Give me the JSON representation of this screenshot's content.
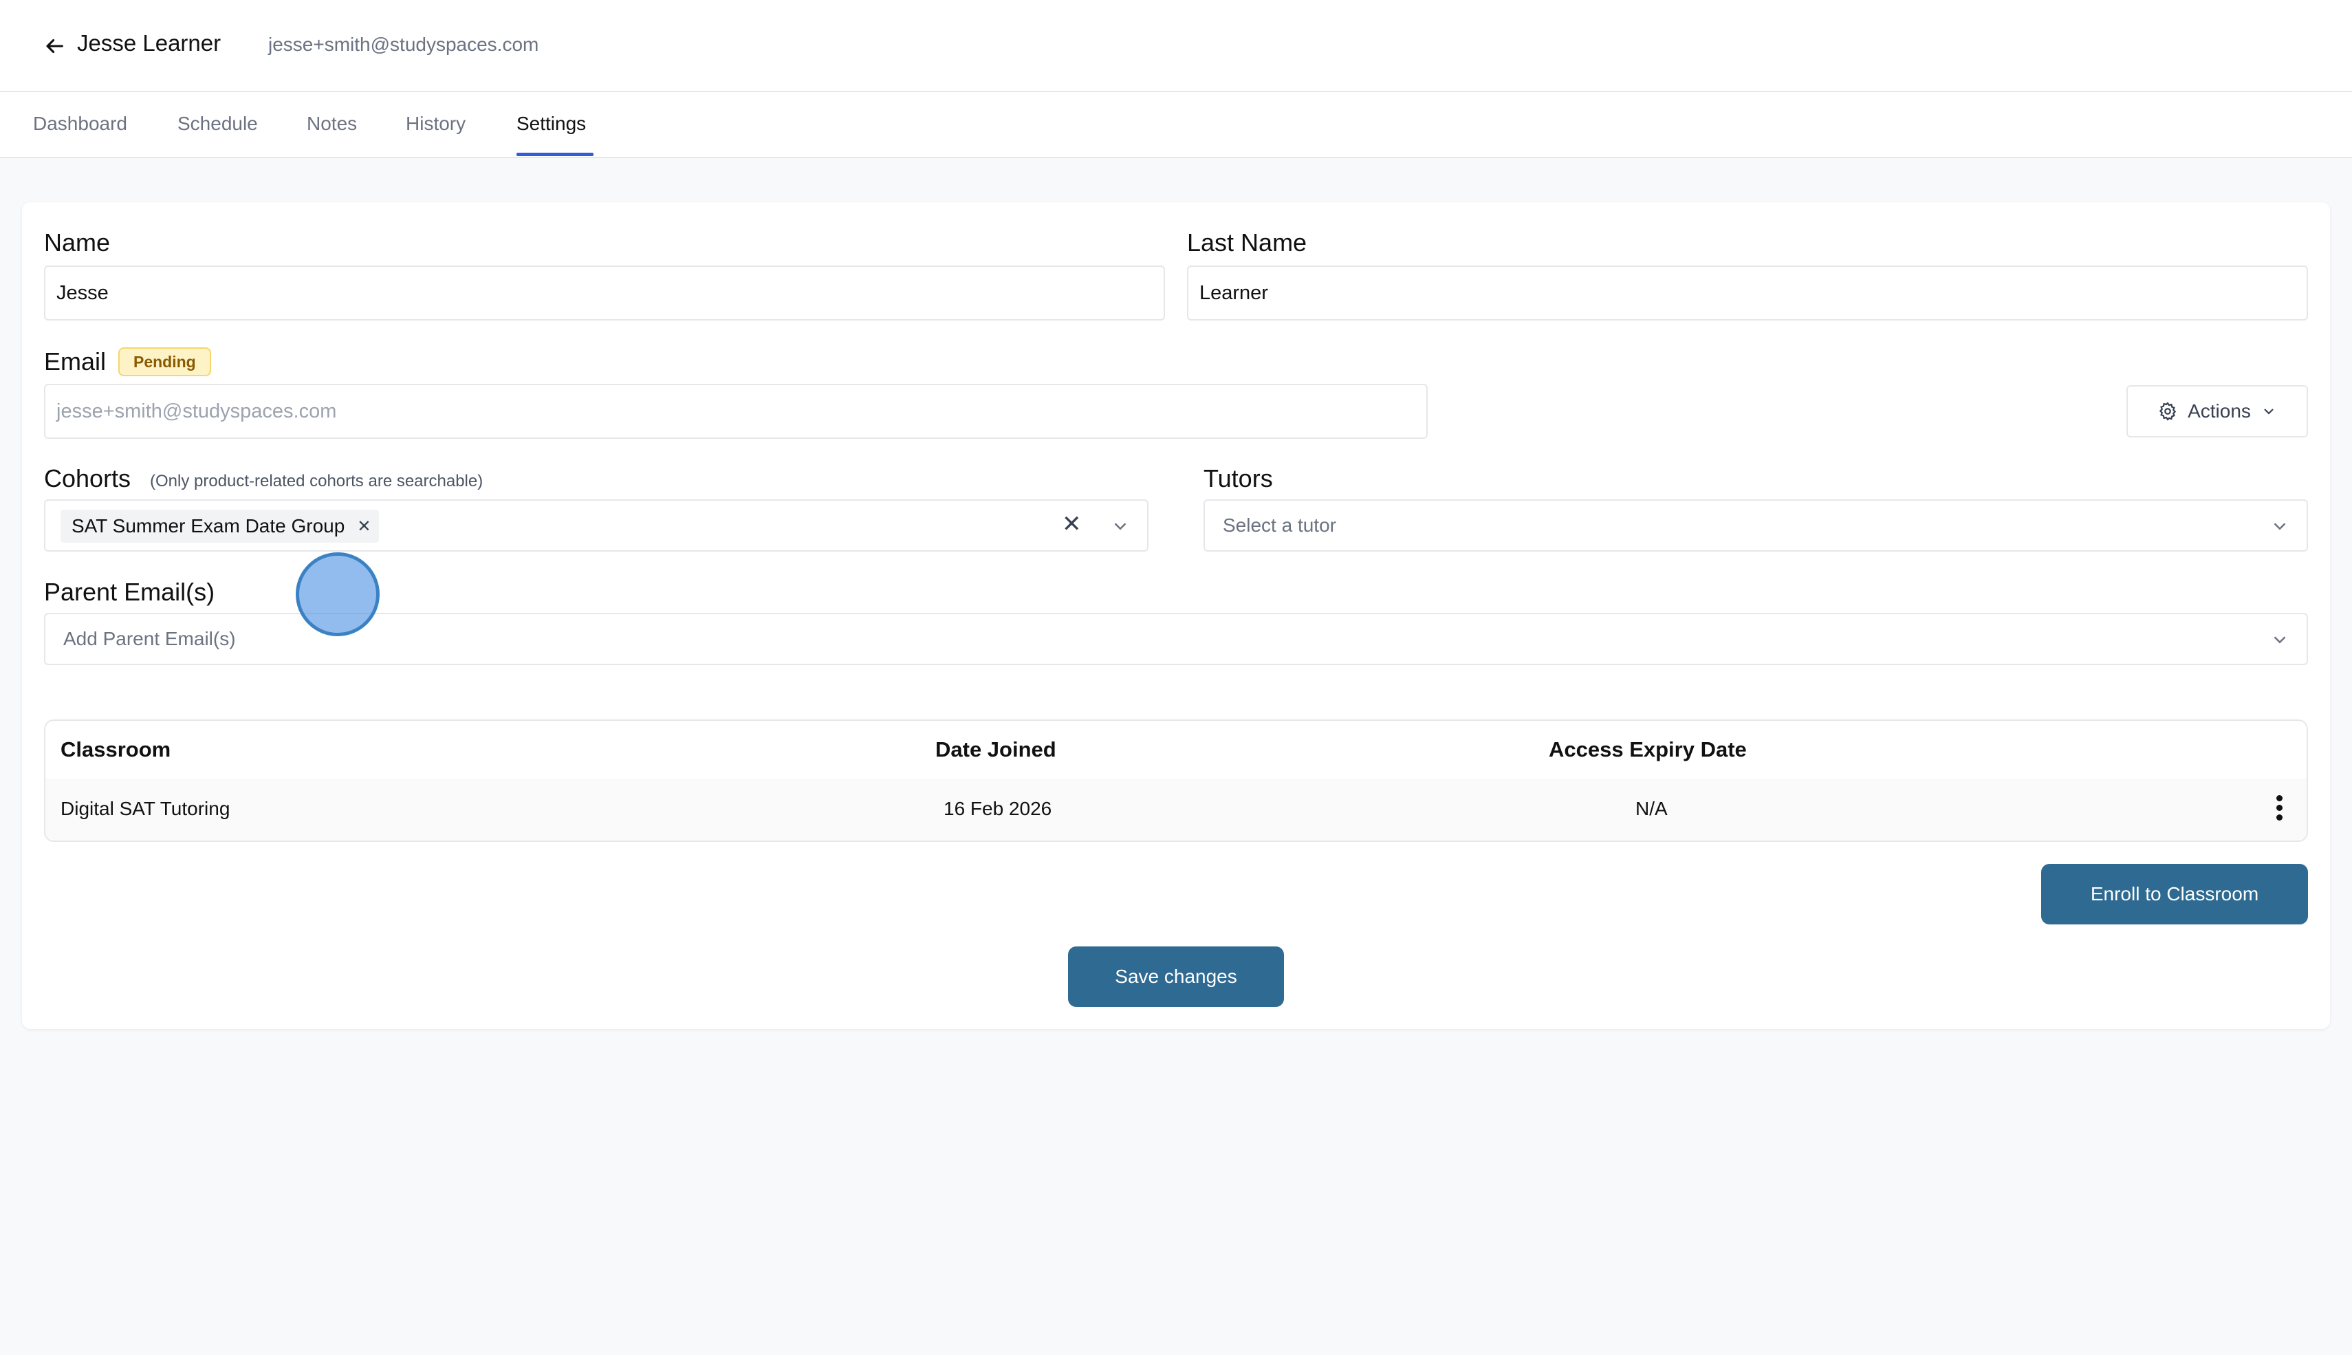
{
  "header": {
    "user_name": "Jesse Learner",
    "user_email": "jesse+smith@studyspaces.com"
  },
  "tabs": [
    {
      "label": "Dashboard",
      "active": false
    },
    {
      "label": "Schedule",
      "active": false
    },
    {
      "label": "Notes",
      "active": false
    },
    {
      "label": "History",
      "active": false
    },
    {
      "label": "Settings",
      "active": true
    }
  ],
  "form": {
    "name_label": "Name",
    "name_value": "Jesse",
    "last_name_label": "Last Name",
    "last_name_value": "Learner",
    "email_label": "Email",
    "email_status": "Pending",
    "email_value": "jesse+smith@studyspaces.com",
    "actions_label": "Actions",
    "cohorts_label": "Cohorts",
    "cohorts_hint": "(Only product-related cohorts are searchable)",
    "cohort_chip": "SAT Summer Exam Date Group",
    "tutors_label": "Tutors",
    "tutors_placeholder": "Select a tutor",
    "parent_label": "Parent Email(s)",
    "parent_placeholder": "Add Parent Email(s)"
  },
  "table": {
    "headers": [
      "Classroom",
      "Date Joined",
      "Access Expiry Date"
    ],
    "rows": [
      {
        "classroom": "Digital SAT Tutoring",
        "date_joined": "16 Feb 2026",
        "expiry": "N/A"
      }
    ]
  },
  "buttons": {
    "enroll": "Enroll to Classroom",
    "save": "Save changes"
  },
  "colors": {
    "primary": "#2f6a92",
    "tab_active": "#2f5fd3",
    "badge_bg": "#fef3c7"
  }
}
